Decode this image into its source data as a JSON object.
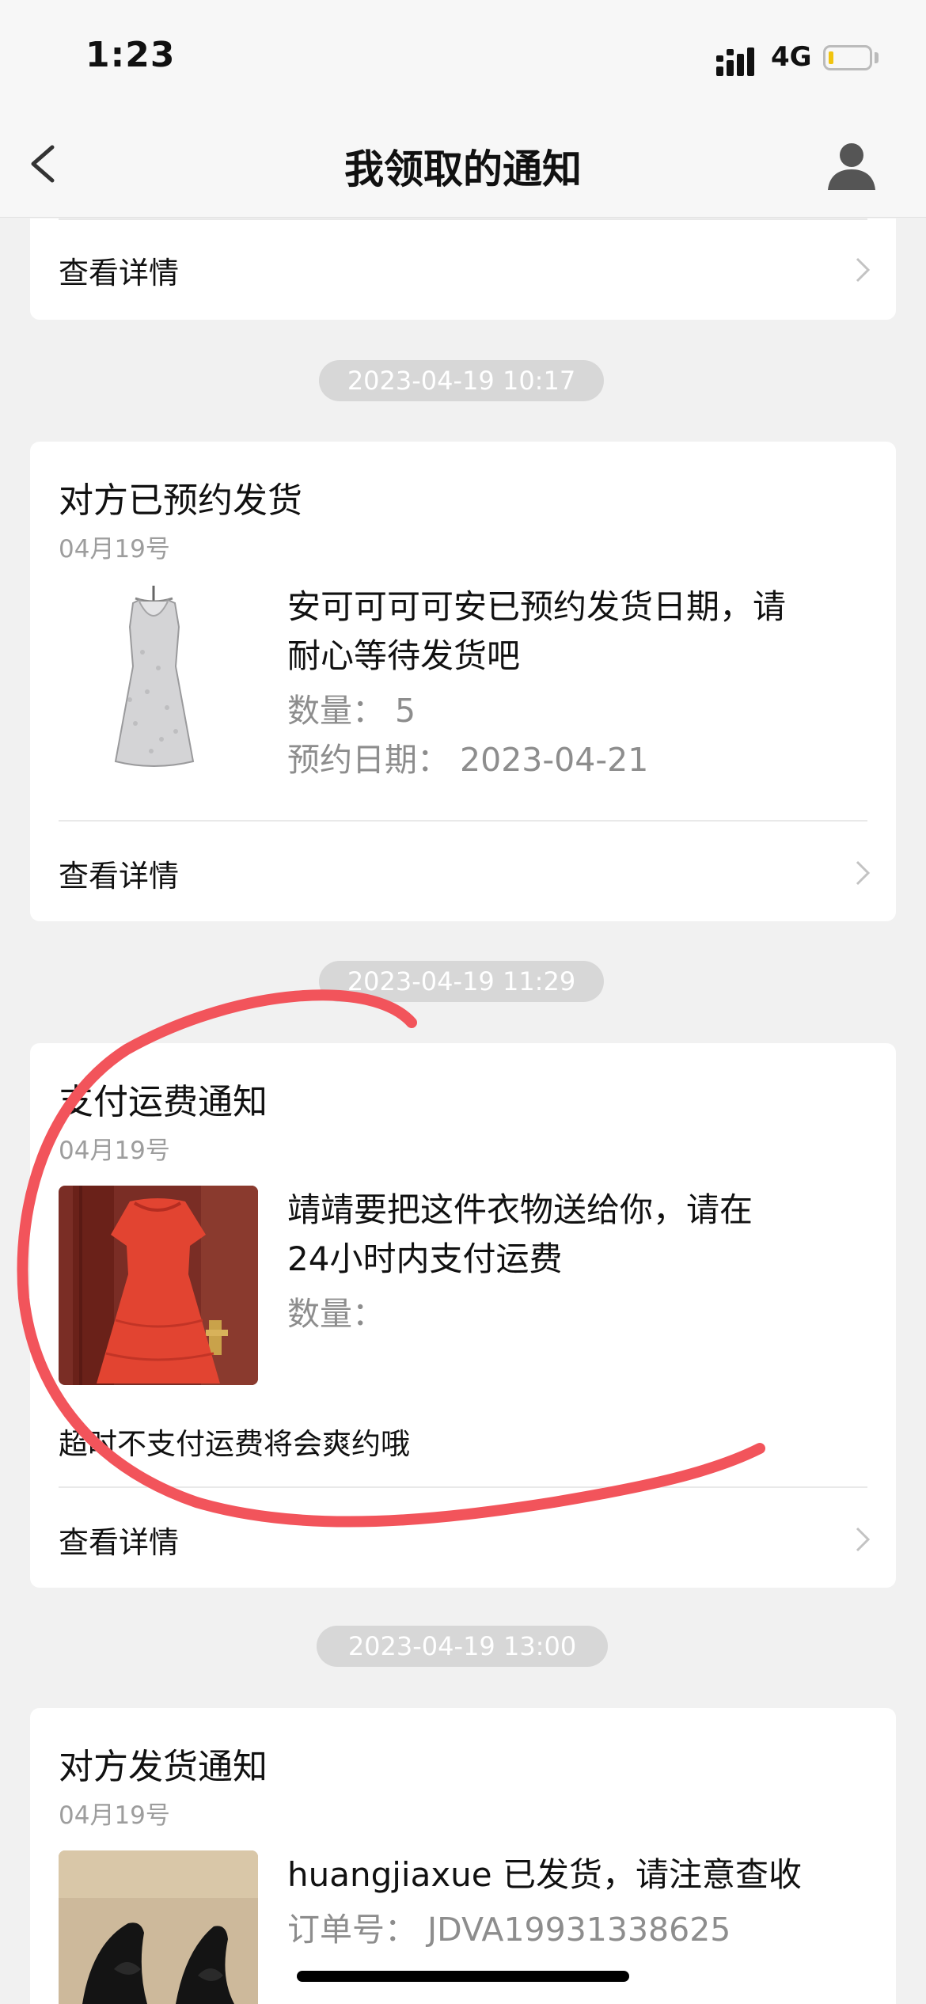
{
  "status_bar": {
    "time": "1:23",
    "network": "4G"
  },
  "nav": {
    "title": "我领取的通知"
  },
  "cards": [
    {
      "detail_label": "查看详情"
    },
    {
      "timestamp": "2023-04-19 10:17",
      "title": "对方已预约发货",
      "date": "04月19号",
      "message_line1": "安可可可可安已预约发货日期，请",
      "message_line2": "耐心等待发货吧",
      "quantity": "数量：  5",
      "scheduled_date": "预约日期：  2023-04-21",
      "detail_label": "查看详情"
    },
    {
      "timestamp": "2023-04-19 11:29",
      "title": "支付运费通知",
      "date": "04月19号",
      "message_line1": "靖靖要把这件衣物送给你，请在",
      "message_line2": "24小时内支付运费",
      "quantity": "数量：",
      "note": "超时不支付运费将会爽约哦",
      "detail_label": "查看详情"
    },
    {
      "timestamp": "2023-04-19 13:00",
      "title": "对方发货通知",
      "date": "04月19号",
      "message_line1": "huangjiaxue 已发货，请注意查收",
      "order_number": "订单号：  JDVA19931338625"
    }
  ],
  "colors": {
    "background": "#f1f1f1",
    "card": "#ffffff",
    "annotation": "#f2545b",
    "timestamp_pill": "#d7d7d7"
  },
  "icons": [
    "back-chevron-icon",
    "user-profile-icon",
    "signal-icon",
    "battery-icon",
    "chevron-right-icon"
  ]
}
